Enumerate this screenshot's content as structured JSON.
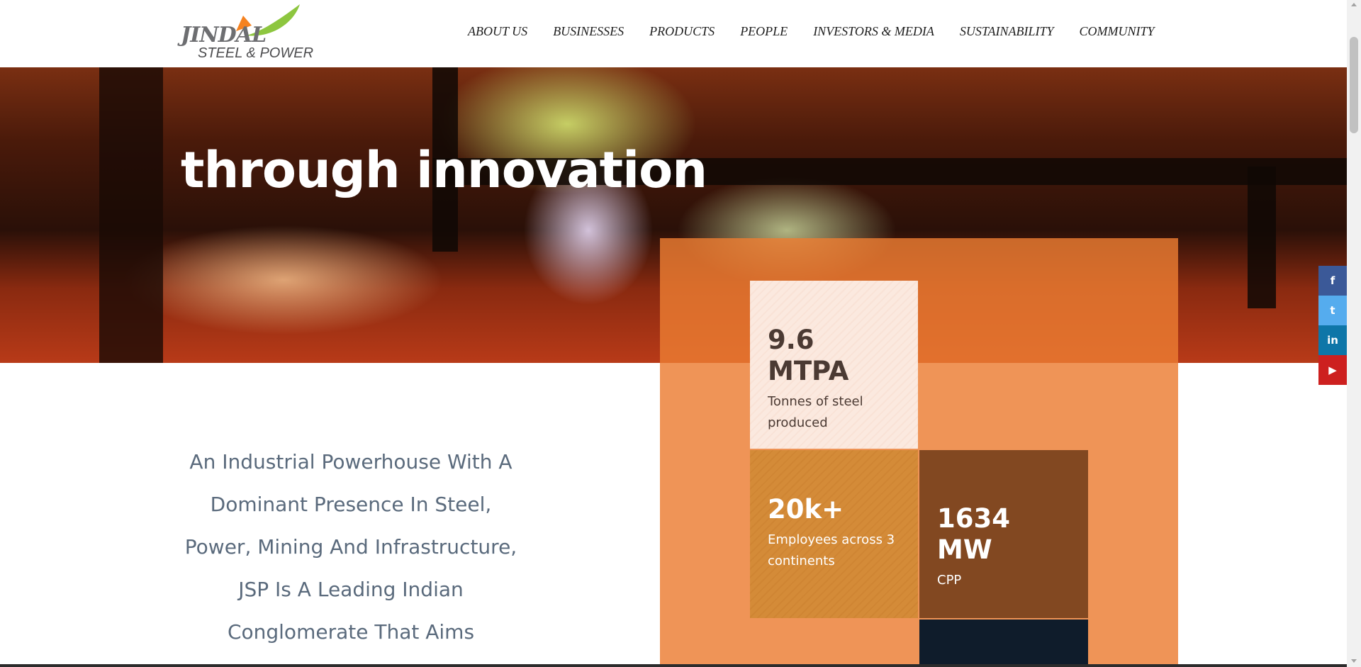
{
  "logo": {
    "word": "JINDAL",
    "sub": "STEEL & POWER"
  },
  "nav": {
    "items": [
      "ABOUT US",
      "BUSINESSES",
      "PRODUCTS",
      "PEOPLE",
      "INVESTORS & MEDIA",
      "SUSTAINABILITY",
      "COMMUNITY"
    ]
  },
  "hero": {
    "title": "through innovation"
  },
  "intro": {
    "text": "An Industrial Powerhouse With A Dominant Presence In Steel, Power, Mining And Infrastructure, JSP Is A Leading Indian Conglomerate That Aims"
  },
  "stats": [
    {
      "value": "9.6 MTPA",
      "label": "Tonnes of steel produced"
    },
    {
      "value": "20k+",
      "label": "Employees across 3 continents"
    },
    {
      "value": "1634 MW",
      "label": "CPP"
    }
  ],
  "social": [
    {
      "icon": "facebook-icon",
      "glyph": "f",
      "color": "#3b5998"
    },
    {
      "icon": "twitter-icon",
      "glyph": "t",
      "color": "#55acee"
    },
    {
      "icon": "linkedin-icon",
      "glyph": "in",
      "color": "#0e76a8"
    },
    {
      "icon": "youtube-icon",
      "glyph": "▶",
      "color": "#cd201f"
    }
  ],
  "colors": {
    "stats_panel": "#eb7d32",
    "stat_light": "#fbe9df",
    "stat_gold": "#d48b38",
    "stat_brown": "#824821",
    "stat_navy": "#0f1c2b",
    "logo_orange": "#f58220",
    "logo_green": "#8dc63f"
  }
}
